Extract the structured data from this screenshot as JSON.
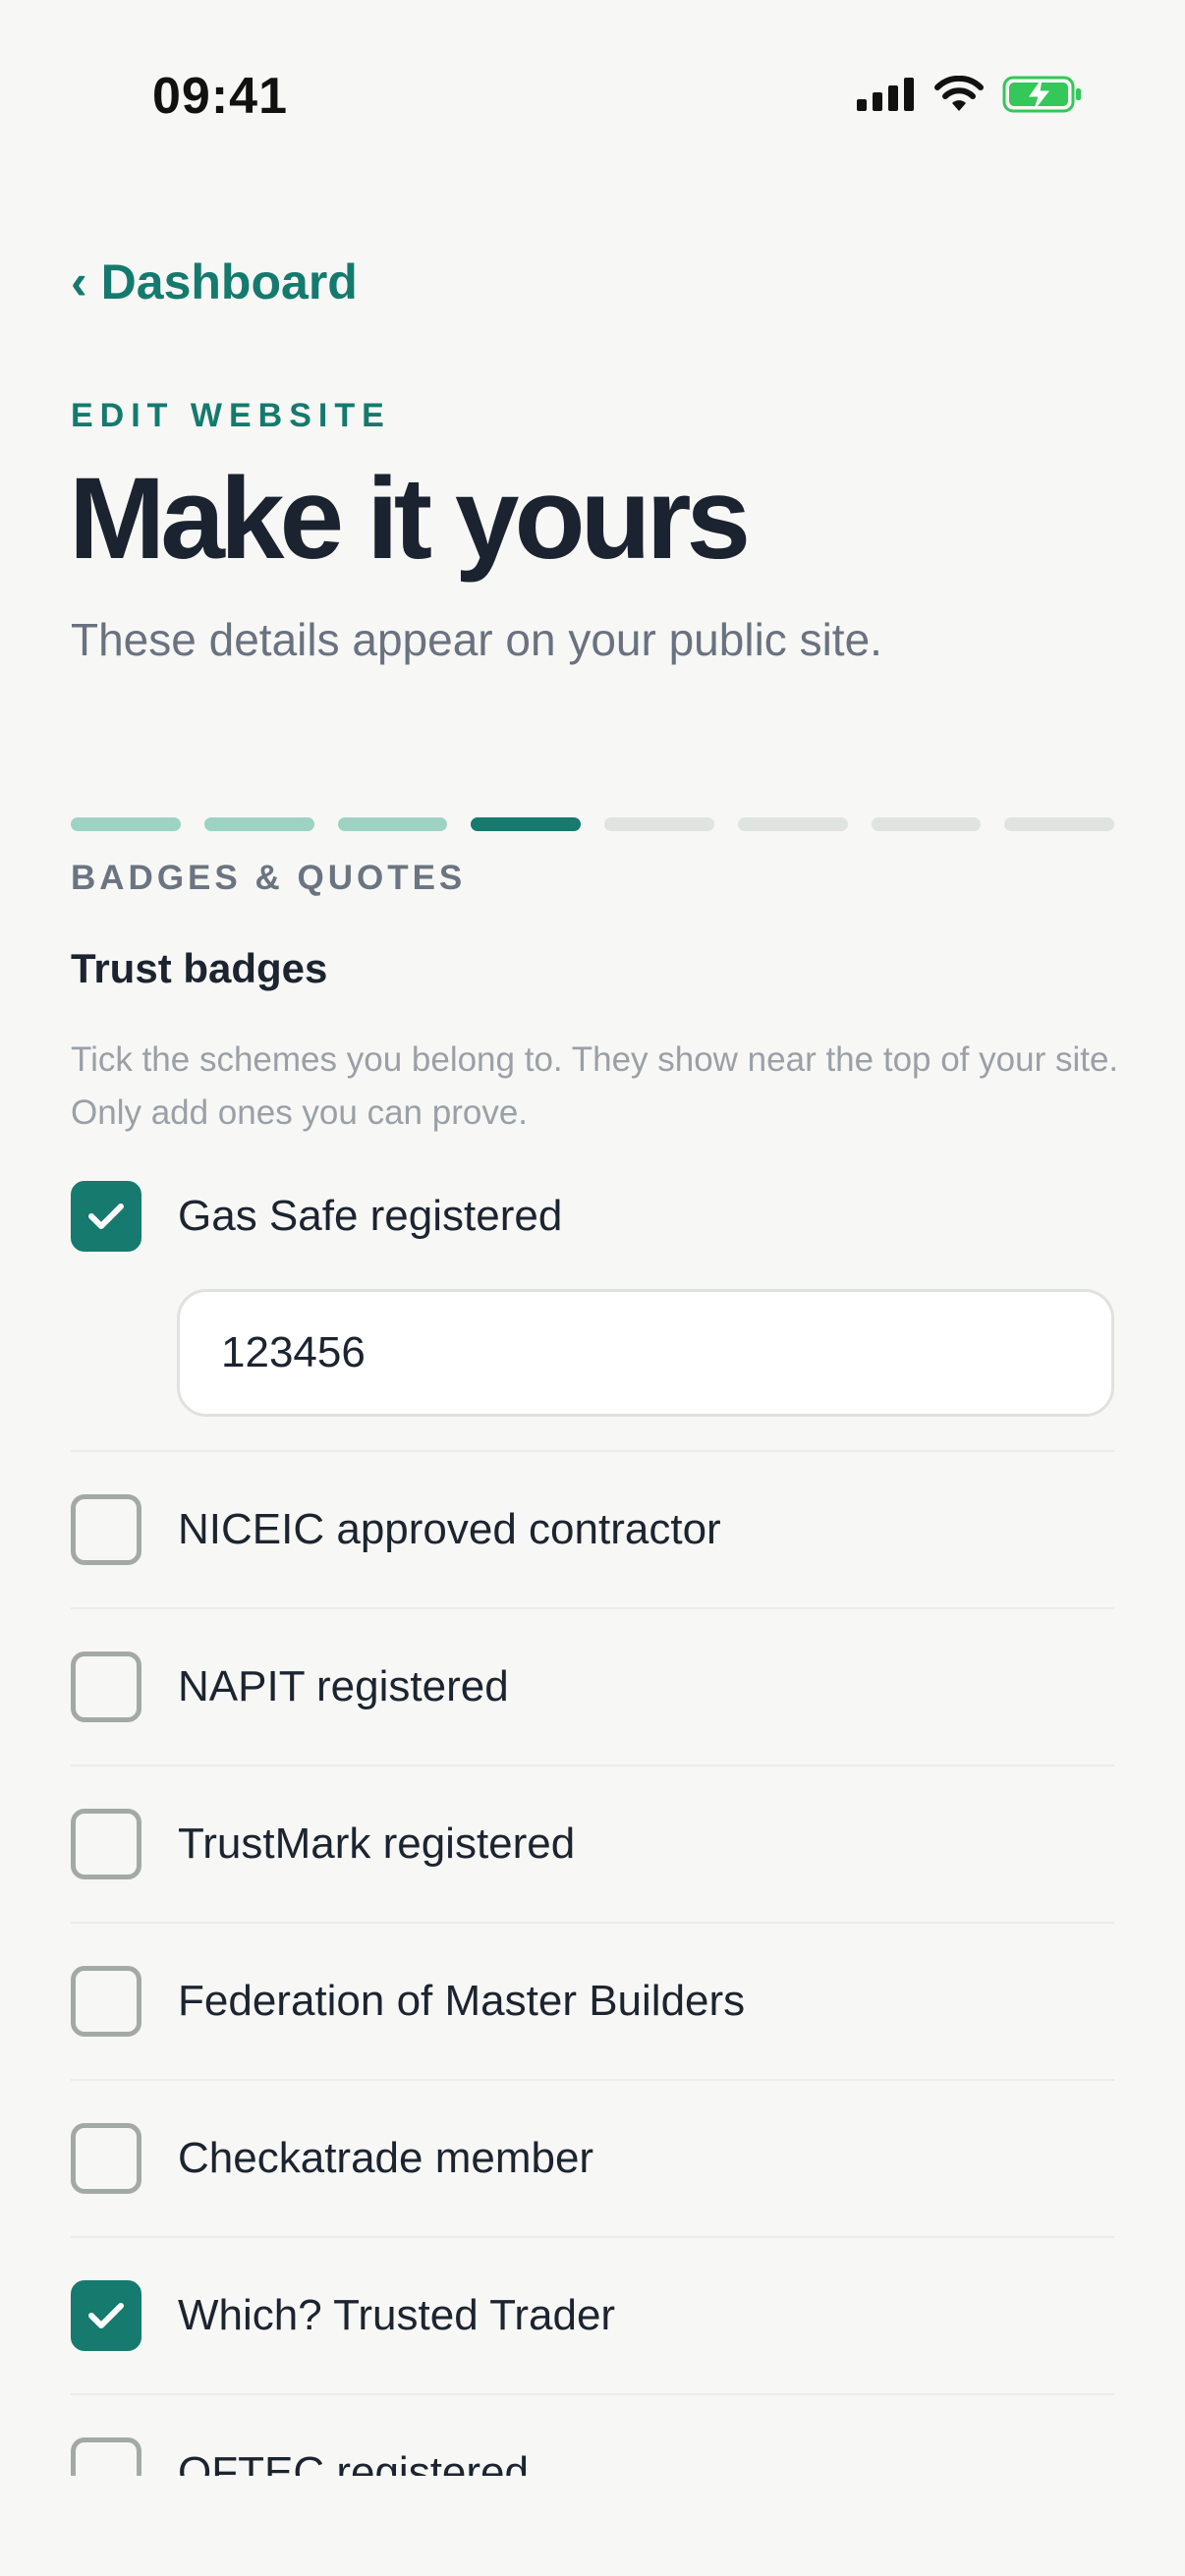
{
  "status_bar": {
    "time": "09:41"
  },
  "nav": {
    "back_label": "Dashboard"
  },
  "header": {
    "eyebrow": "EDIT WEBSITE",
    "title": "Make it yours",
    "subtitle": "These details appear on your public site."
  },
  "progress": {
    "total_steps": 8,
    "current_step": 4
  },
  "section": {
    "label": "BADGES & QUOTES",
    "group_title": "Trust badges",
    "help_text": "Tick the schemes you belong to. They show near the top of your site. Only add ones you can prove."
  },
  "badges": [
    {
      "label": "Gas Safe registered",
      "checked": true,
      "reg_number": "123456"
    },
    {
      "label": "NICEIC approved contractor",
      "checked": false
    },
    {
      "label": "NAPIT registered",
      "checked": false
    },
    {
      "label": "TrustMark registered",
      "checked": false
    },
    {
      "label": "Federation of Master Builders",
      "checked": false
    },
    {
      "label": "Checkatrade member",
      "checked": false
    },
    {
      "label": "Which? Trusted Trader",
      "checked": true
    },
    {
      "label": "OFTEC registered",
      "checked": false
    }
  ],
  "colors": {
    "accent": "#167a6e",
    "progress_done": "#9ed3c4",
    "progress_todo": "#e0e4e1",
    "background": "#f7f7f5"
  }
}
